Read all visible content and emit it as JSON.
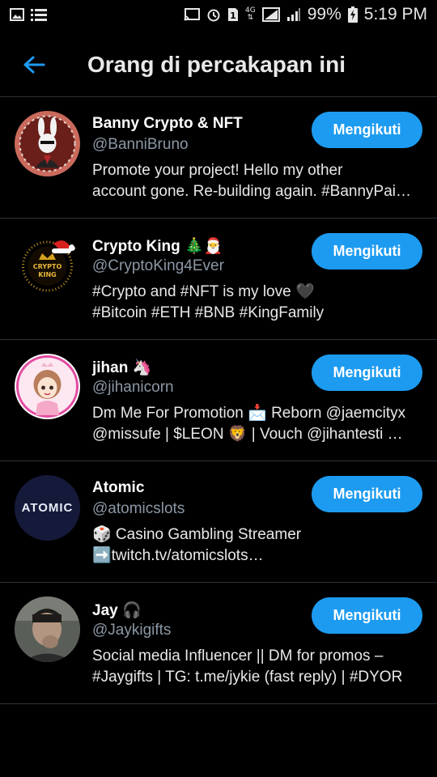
{
  "status_bar": {
    "battery_percent": "99%",
    "time": "5:19 PM",
    "network": "4G"
  },
  "header": {
    "title": "Orang di percakapan ini"
  },
  "accent_color": "#1d9bf0",
  "users": [
    {
      "name": "Banny Crypto & NFT",
      "handle": "@BanniBruno",
      "bio_line1": "Promote your project! Hello my other",
      "bio_line2": "account gone. Re-building again. #BannyPai…",
      "button": "Mengikuti"
    },
    {
      "name": "Crypto King 🎄🎅",
      "handle": "@CryptoKing4Ever",
      "bio_line1": "#Crypto and #NFT is my love 🖤",
      "bio_line2": "#Bitcoin #ETH #BNB #KingFamily",
      "button": "Mengikuti",
      "avatar_text": [
        "CRYPTO",
        "KING"
      ]
    },
    {
      "name": "jihan 🦄",
      "handle": "@jihanicorn",
      "bio_line1": "Dm Me For Promotion 📩 Reborn @jaemcityx",
      "bio_line2": "@missufe | $LEON 🦁 | Vouch @jihantesti …",
      "button": "Mengikuti"
    },
    {
      "name": "Atomic",
      "handle": "@atomicslots",
      "bio_line1": "🎲 Casino Gambling Streamer",
      "bio_line2": "➡️twitch.tv/atomicslots…",
      "button": "Mengikuti",
      "avatar_text": "ATOMIC"
    },
    {
      "name": "Jay 🎧",
      "handle": "@Jaykigifts",
      "bio_line1": "Social media Influencer || DM for promos –",
      "bio_line2": "#Jaygifts | TG: t.me/jykie (fast reply) | #DYOR",
      "button": "Mengikuti"
    }
  ]
}
